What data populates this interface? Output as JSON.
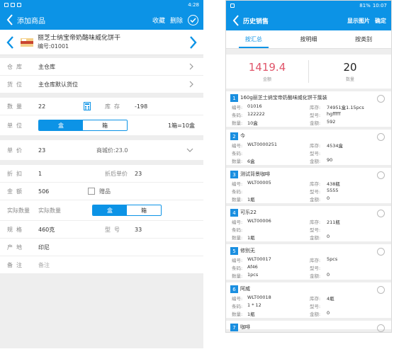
{
  "left": {
    "status": {
      "time": "4:28"
    },
    "title": "添加商品",
    "actions": {
      "collect": "收藏",
      "delete": "删除"
    },
    "product": {
      "name": "丽芝士纳宝帝奶酪味威化饼干",
      "code": "编号:01001"
    },
    "rows": {
      "warehouse": {
        "label": "仓库",
        "value": "主仓库"
      },
      "location": {
        "label": "货位",
        "value": "主仓库默认货位"
      },
      "qty": {
        "label": "数量",
        "value": "22",
        "label2": "库存",
        "value2": "-198"
      },
      "unit": {
        "label": "单位",
        "opt1": "盒",
        "opt2": "箱",
        "note": "1箱=10盒"
      },
      "price": {
        "label": "单价",
        "value": "23",
        "hint": "商城价:23.0"
      },
      "discount": {
        "label": "折扣",
        "value": "1",
        "label2": "折后单价",
        "value2": "23"
      },
      "amount": {
        "label": "金额",
        "value": "506",
        "gift": "赠品"
      },
      "actual": {
        "label1": "实际数量",
        "label2": "实际数量",
        "opt1": "盒",
        "opt2": "箱"
      },
      "spec": {
        "label": "规格",
        "value": "460克",
        "label2": "型号",
        "value2": "33"
      },
      "origin": {
        "label": "产地",
        "value": "印尼"
      },
      "remark": {
        "label": "备注",
        "value": "备注"
      }
    }
  },
  "right": {
    "status": {
      "time": "10:07",
      "battery": "81%"
    },
    "title": "历史销售",
    "actions": {
      "show_image": "显示图片",
      "confirm": "确定"
    },
    "tabs": [
      "按汇总",
      "按明细",
      "按类别"
    ],
    "summary": {
      "amount": "1419.4",
      "amount_label": "金额",
      "count": "20",
      "count_label": "数量"
    },
    "items": [
      {
        "no": "1",
        "name": "160g丽芝士纳宝帝奶酪味威化饼干簇装",
        "code": "01016",
        "stock": "74951盒1.15pcs",
        "barcode": "122222",
        "model": "hgfffff",
        "qty": "10盒",
        "amount": "592"
      },
      {
        "no": "2",
        "name": "今",
        "code": "WLT0000251",
        "stock": "4534盒",
        "barcode": "",
        "model": "",
        "qty": "6盒",
        "amount": "90"
      },
      {
        "no": "3",
        "name": "测试背景咖啡",
        "code": "WLT00005",
        "stock": "438瓶",
        "barcode": "",
        "model": "5555",
        "qty": "1瓶",
        "amount": "0"
      },
      {
        "no": "4",
        "name": "可乐22",
        "code": "WLT00006",
        "stock": "211瓶",
        "barcode": "",
        "model": "",
        "qty": "1瓶",
        "amount": "0"
      },
      {
        "no": "5",
        "name": "修别无",
        "code": "WLT00017",
        "stock": "5pcs",
        "barcode": "Af46",
        "model": "",
        "qty": "1pcs",
        "amount": "0"
      },
      {
        "no": "6",
        "name": "阿威",
        "code": "WLT00018",
        "stock": "4瓶",
        "barcode": "1 * 12",
        "model": "",
        "qty": "1瓶",
        "amount": "0"
      },
      {
        "no": "7",
        "name": "咖啡"
      }
    ],
    "labels": {
      "code": "编号:",
      "stock": "库存:",
      "barcode": "条码:",
      "model": "型号:",
      "qty": "数量:",
      "amount": "金额:"
    }
  },
  "colors": {
    "primary": "#0c93e6",
    "amount_red": "#e0556a"
  },
  "icons": [
    "back-icon",
    "check-circle-icon",
    "chevron-left-icon",
    "chevron-right-icon",
    "calculator-icon",
    "chevron-down-icon"
  ]
}
